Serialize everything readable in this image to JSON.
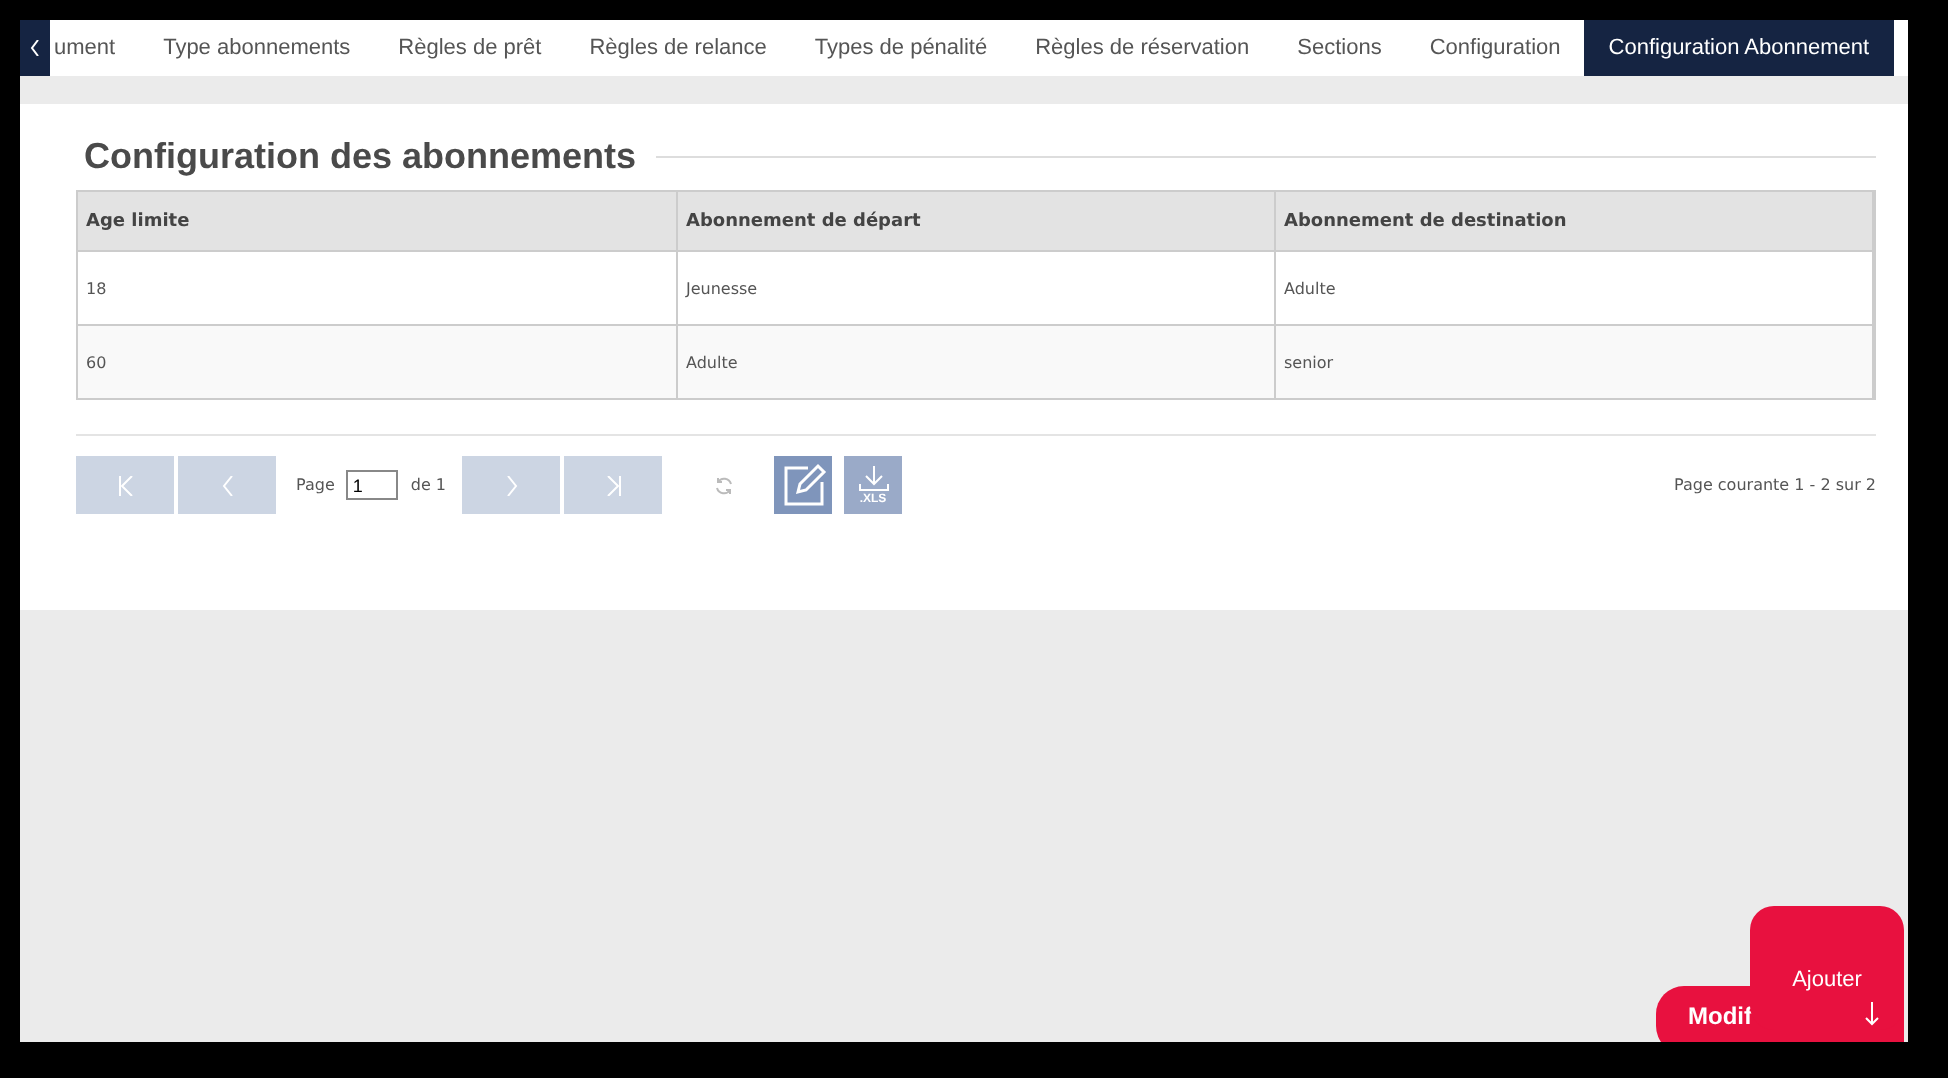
{
  "tabs": [
    {
      "label": "ument",
      "selected": false
    },
    {
      "label": "Type abonnements",
      "selected": false
    },
    {
      "label": "Règles de prêt",
      "selected": false
    },
    {
      "label": "Règles de relance",
      "selected": false
    },
    {
      "label": "Types de pénalité",
      "selected": false
    },
    {
      "label": "Règles de réservation",
      "selected": false
    },
    {
      "label": "Sections",
      "selected": false
    },
    {
      "label": "Configuration",
      "selected": false
    },
    {
      "label": "Configuration Abonnement",
      "selected": true
    }
  ],
  "section_title": "Configuration des abonnements",
  "table": {
    "columns": [
      "Age limite",
      "Abonnement de départ",
      "Abonnement de destination"
    ],
    "rows": [
      [
        "18",
        "Jeunesse",
        "Adulte"
      ],
      [
        "60",
        "Adulte",
        "senior"
      ]
    ]
  },
  "pager": {
    "page_label": "Page",
    "page_value": "1",
    "page_total": "de 1",
    "status": "Page courante 1 - 2 sur 2",
    "nav_buttons": [
      {
        "kind": "first",
        "disabled": true
      },
      {
        "kind": "prev",
        "disabled": true
      },
      {
        "kind": "next",
        "disabled": true
      },
      {
        "kind": "last",
        "disabled": true
      }
    ],
    "export_label": ".XLS"
  },
  "fab": {
    "secondary_label": "Modif",
    "primary_label": "Ajouter"
  }
}
